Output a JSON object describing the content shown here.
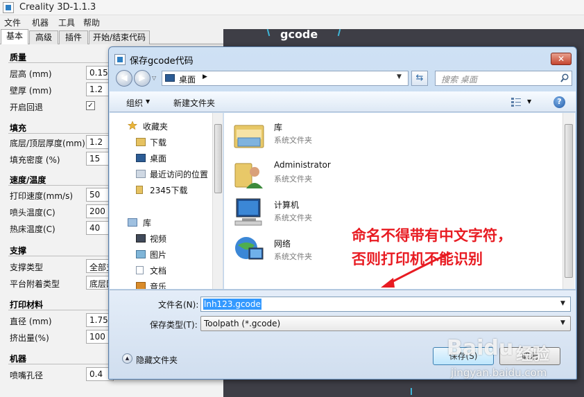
{
  "app": {
    "title": "Creality 3D-1.1.3",
    "menus": [
      "文件",
      "机器",
      "工具",
      "帮助"
    ],
    "tabs": [
      "基本",
      "高级",
      "插件",
      "开始/结束代码"
    ],
    "viewport_label": "gcode"
  },
  "sections": {
    "quality": {
      "title": "质量",
      "layer_height": {
        "label": "层高 (mm)",
        "value": "0.15"
      },
      "wall_thickness": {
        "label": "壁厚 (mm)",
        "value": "1.2"
      },
      "retraction": {
        "label": "开启回退",
        "checked": true,
        "mark": "✓"
      }
    },
    "fill": {
      "title": "填充",
      "bottom_top": {
        "label": "底层/顶层厚度(mm)",
        "value": "1.2"
      },
      "density": {
        "label": "填充密度 (%)",
        "value": "15"
      }
    },
    "speed": {
      "title": "速度/温度",
      "print_speed": {
        "label": "打印速度(mm/s)",
        "value": "50"
      },
      "nozzle_temp": {
        "label": "喷头温度(C)",
        "value": "200"
      },
      "bed_temp": {
        "label": "热床温度(C)",
        "value": "40"
      }
    },
    "support": {
      "title": "支撑",
      "support_type": {
        "label": "支撑类型",
        "value": "全部支"
      },
      "adhesion": {
        "label": "平台附着类型",
        "value": "底层网"
      }
    },
    "filament": {
      "title": "打印材料",
      "diameter": {
        "label": "直径 (mm)",
        "value": "1.75"
      },
      "flow": {
        "label": "挤出量(%)",
        "value": "100"
      }
    },
    "machine": {
      "title": "机器",
      "nozzle": {
        "label": "喷嘴孔径",
        "value": "0.4"
      }
    }
  },
  "dialog": {
    "title": "保存gcode代码",
    "close": "✕",
    "nav_back": "◀",
    "nav_forward": "▶",
    "nav_recent": "▽",
    "address": {
      "location": "桌面",
      "arrow": "▶",
      "dropdown": "▼"
    },
    "refresh": "⇆",
    "search_placeholder": "搜索 桌面",
    "toolbar": {
      "organize": "组织",
      "organize_arrow": "▼",
      "new_folder": "新建文件夹",
      "view_arrow": "▼",
      "help": "?"
    },
    "nav_items": {
      "favorites": "收藏夹",
      "downloads": "下载",
      "desktop": "桌面",
      "recent": "最近访问的位置",
      "downloads_2345": "2345下载",
      "libraries": "库",
      "videos": "视频",
      "pictures": "图片",
      "documents": "文档",
      "music": "音乐"
    },
    "files": [
      {
        "name": "库",
        "type": "系统文件夹",
        "icon": "library-folder-icon"
      },
      {
        "name": "Administrator",
        "type": "系统文件夹",
        "icon": "user-folder-icon"
      },
      {
        "name": "计算机",
        "type": "系统文件夹",
        "icon": "computer-icon"
      },
      {
        "name": "网络",
        "type": "系统文件夹",
        "icon": "network-icon"
      }
    ],
    "filename_label": "文件名(N):",
    "filename_value": "lnh123.gcode",
    "filetype_label": "保存类型(T):",
    "filetype_value": "Toolpath (*.gcode)",
    "dropdown_arrow": "▼",
    "hide_folders": "隐藏文件夹",
    "hide_toggle": "▲",
    "save_button": "保存(S)",
    "cancel_button": "取消"
  },
  "annotation": {
    "line1": "命名不得带有中文字符，",
    "line2": "否则打印机不能识别"
  },
  "watermark": {
    "logo": "Baidu",
    "logo_suffix": "经验",
    "url": "jingyan.baidu.com"
  },
  "colors": {
    "annotation": "#e81b22",
    "selection": "#3399ff",
    "viewport": "#3e3e46",
    "accent": "#2e7fc3"
  }
}
